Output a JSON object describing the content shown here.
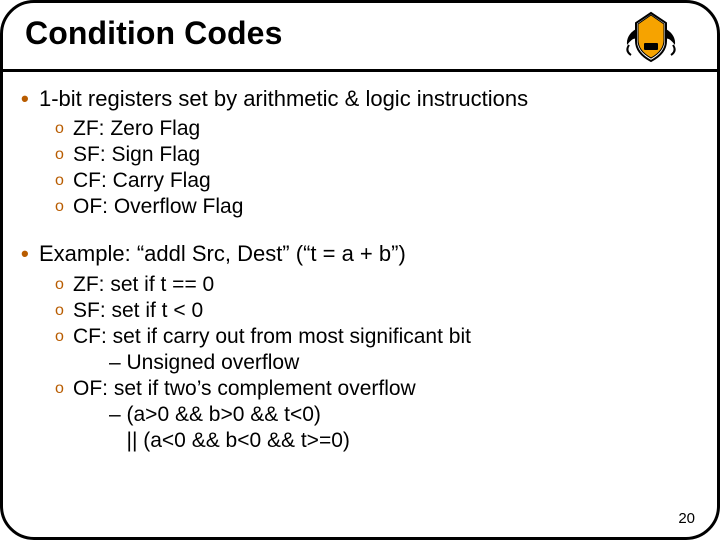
{
  "header": {
    "title": "Condition Codes"
  },
  "section1": {
    "heading": "1-bit registers set by arithmetic & logic instructions",
    "items": [
      "ZF: Zero Flag",
      "SF: Sign Flag",
      "CF: Carry Flag",
      "OF: Overflow Flag"
    ]
  },
  "section2": {
    "heading": "Example: “addl Src, Dest” (“t = a + b”)",
    "items": {
      "zf": "ZF: set if t == 0",
      "sf": "SF: set if t < 0",
      "cf": "CF: set if carry out from most significant bit",
      "cf_sub": "– Unsigned overflow",
      "of": "OF: set if two’s complement overflow",
      "of_sub1": "– (a>0 && b>0 && t<0)",
      "of_sub2": "   || (a<0 && b<0 && t>=0)"
    }
  },
  "page_number": "20",
  "colors": {
    "accent": "#b85c00"
  }
}
